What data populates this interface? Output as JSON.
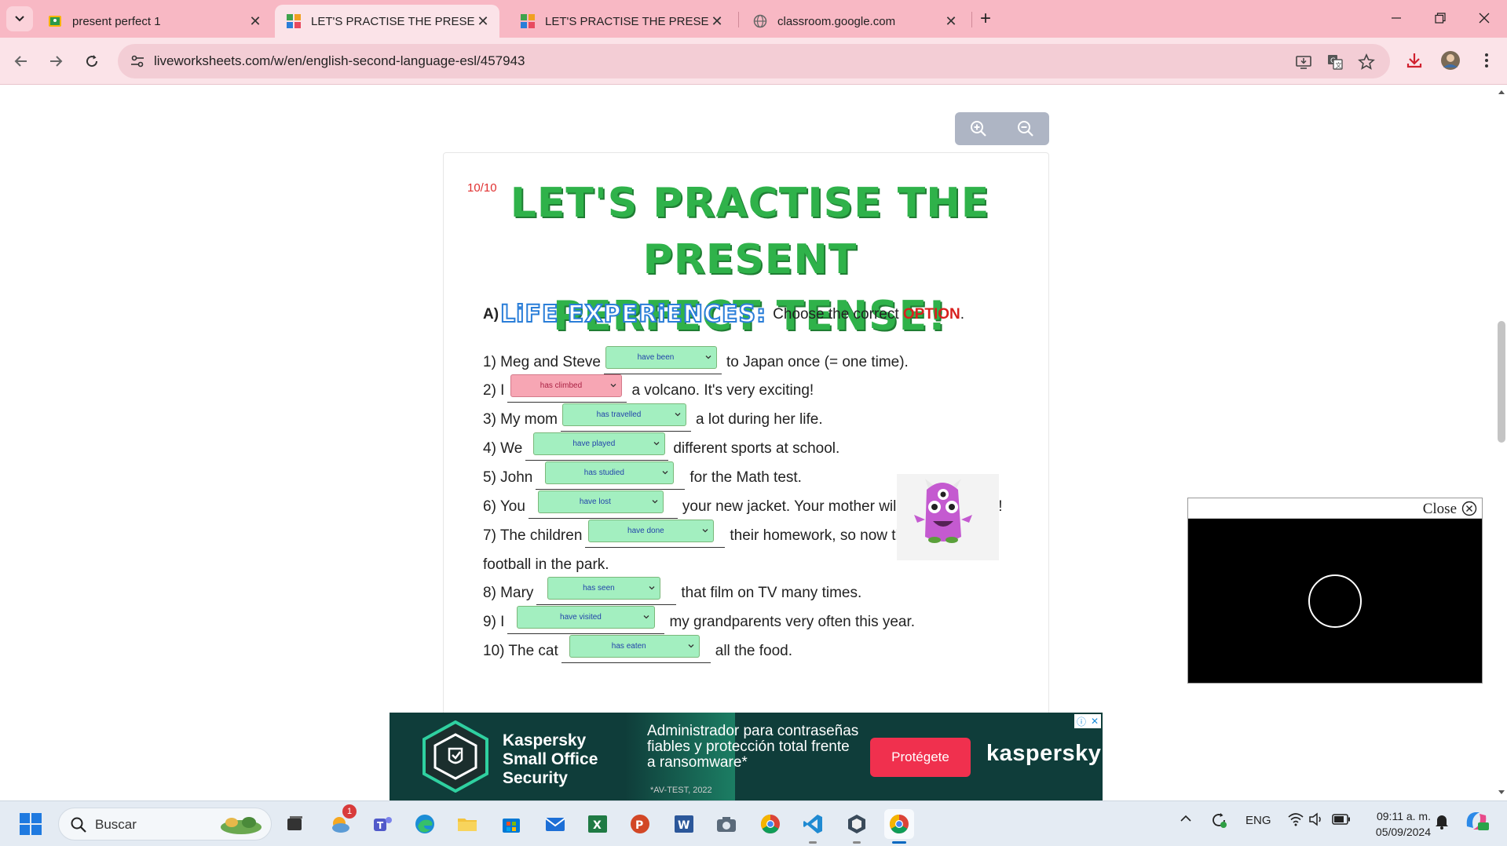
{
  "browser": {
    "tabs": [
      {
        "title": "present perfect 1",
        "favicon": "google-classroom-icon",
        "active": false
      },
      {
        "title": "LET'S PRACTISE THE PRESENT PERFECT TENSE!",
        "favicon": "liveworksheets-icon",
        "active": true
      },
      {
        "title": "LET'S PRACTISE THE PRESENT PERFECT TENSE!",
        "favicon": "liveworksheets-icon",
        "active": false
      },
      {
        "title": "classroom.google.com",
        "favicon": "globe-icon",
        "active": false
      }
    ],
    "url": "liveworksheets.com/w/en/english-second-language-esl/457943"
  },
  "worksheet": {
    "score": "10/10",
    "title_line1": "LET'S PRACTISE THE PRESENT",
    "title_line2": "PERFECT TENSE!",
    "section_letter": "A)",
    "section_name": "LiFE EXPERiENCES:",
    "instruction": "Choose the correct",
    "instruction_highlight": "OPTION",
    "instruction_end": ".",
    "items": [
      {
        "before": "1) Meg and Steve",
        "answer": "have been",
        "after": "to Japan once (= one time).",
        "correct": true
      },
      {
        "before": "2) I",
        "answer": "has climbed",
        "after": "a volcano. It's very exciting!",
        "correct": false
      },
      {
        "before": "3) My mom",
        "answer": "has travelled",
        "after": "a lot during her life.",
        "correct": true
      },
      {
        "before": "4) We",
        "answer": "have played",
        "after": "different sports at school.",
        "correct": true
      },
      {
        "before": "5) John",
        "answer": "has studied",
        "after": "for the Math test.",
        "correct": true
      },
      {
        "before": "6) You",
        "answer": "have lost",
        "after": "your new jacket. Your mother will get very angry!",
        "correct": true
      },
      {
        "before": "7) The children",
        "answer": "have done",
        "after": "their homework, so now they are playing",
        "correct": true
      },
      {
        "before": "football in the park.",
        "answer": "",
        "after": "",
        "correct": true
      },
      {
        "before": "8) Mary",
        "answer": "has seen",
        "after": "that film on TV many times.",
        "correct": true
      },
      {
        "before": "9) I",
        "answer": "have visited",
        "after": "my grandparents very often this year.",
        "correct": true
      },
      {
        "before": "10) The cat",
        "answer": "has eaten",
        "after": "all the food.",
        "correct": true
      }
    ]
  },
  "video": {
    "close_label": "Close"
  },
  "ad": {
    "brand": "Kaspersky Small Office Security",
    "brand_l1": "Kaspersky",
    "brand_l2": "Small Office",
    "brand_l3": "Security",
    "msg_l1": "Administrador para contraseñas",
    "msg_l2": "fiables y protección total frente",
    "msg_l3": "a ransomware*",
    "fine": "*AV-TEST, 2022",
    "cta": "Protégete",
    "logo": "kaspersky"
  },
  "taskbar": {
    "search_placeholder": "Buscar",
    "notification_badge": "1",
    "language": "ENG",
    "time": "09:11 a. m.",
    "date": "05/09/2024"
  },
  "colors": {
    "tabbar": "#f8b8c4",
    "title_green": "#2fb24a",
    "correct_select": "#a3efc0",
    "wrong_select": "#f7a6b4",
    "option_red": "#d8201e"
  }
}
